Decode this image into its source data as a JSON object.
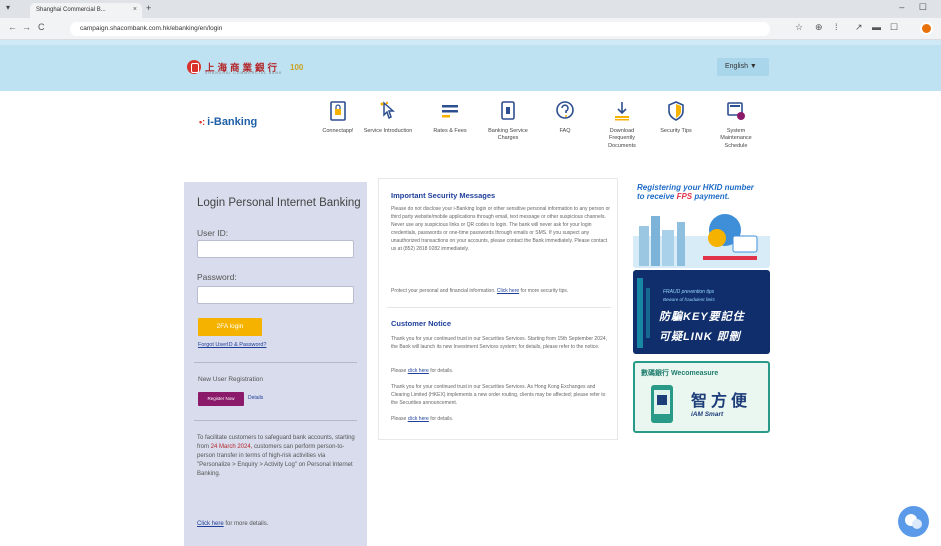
{
  "browser": {
    "tab_title": "Shanghai Commercial B...",
    "tab_close": "×",
    "new_tab": "+",
    "tabs_menu": "▾",
    "window_controls": "–  ☐",
    "nav": {
      "back": "←",
      "forward": "→",
      "reload": "C"
    },
    "url": "campaign.shacombank.com.hk/ebanking/en/login",
    "toolbar_icons": [
      "☆",
      "⊕",
      "⁞",
      "↗",
      "▬",
      "☐"
    ]
  },
  "header": {
    "bank_name": "上海商業銀行",
    "bank_name_en": "SHANGHAI COMMERCIAL BANK",
    "anniversary": "100",
    "language": "English ▼"
  },
  "ibanking": {
    "dots": "•:",
    "label": "i-Banking"
  },
  "menu": [
    {
      "label": "Connectapp!",
      "icon": "doc-lock-icon"
    },
    {
      "label": "Service Introduction",
      "icon": "pointer-icon"
    },
    {
      "label": "Rates & Fees",
      "icon": "rates-icon"
    },
    {
      "label": "Banking Service Charges",
      "icon": "document-icon"
    },
    {
      "label": "FAQ",
      "icon": "faq-icon"
    },
    {
      "label": "Download Frequently Documents",
      "icon": "download-icon"
    },
    {
      "label": "Security Tips",
      "icon": "shield-icon"
    },
    {
      "label": "System Maintenance Schedule",
      "icon": "maintenance-icon"
    }
  ],
  "login": {
    "title": "Login Personal Internet Banking",
    "user_id_label": "User ID:",
    "password_label": "Password:",
    "login_button": "2FA login",
    "forgot_link": "Forgot UserID & Password?",
    "new_user_label": "New User Registration",
    "register_button": "Register Now",
    "register_link": "Details",
    "notice_lead": "To facilitate customers to safeguard bank accounts, starting from",
    "notice_date": "24 March 2024,",
    "notice_rest": "customers can perform person-to-person transfer in terms of high-risk activities via \"Personalize > Enquiry > Activity Log\" on Personal Internet Banking.",
    "click_here": "Click here",
    "click_here_suffix": " for more details."
  },
  "security": {
    "heading": "Important Security Messages",
    "para1": "Please do not disclose your i-Banking login or other sensitive personal information to any person or third party website/mobile applications through email, text message or other suspicious channels. Never use any suspicious links or QR codes to login. The bank will never ask for your login credentials, passwords or one-time passwords through emails or SMS. If you suspect any unauthorized transactions on your accounts, please contact the Bank immediately. Please contact us at (852) 2818 0282 immediately.",
    "para2_prefix": "Protect your personal and financial information. ",
    "para2_link": "Click here",
    "para2_suffix": " for more security tips."
  },
  "customer_notice": {
    "heading": "Customer Notice",
    "para1": "Thank you for your continued trust in our Securities Services. Starting from 15th September 2024, the Bank will launch its new Investment Services system; for details, please refer to the notice.",
    "line2_prefix": "Please ",
    "line2_link": "click here",
    "line2_suffix": " for details.",
    "para3": "Thank you for your continued trust in our Securities Services. As Hong Kong Exchanges and Clearing Limited (HKEX) implements a new order routing, clients may be affected; please refer to the Securities announcement.",
    "line4_prefix": "Please ",
    "line4_link": "click here",
    "line4_suffix": " for details."
  },
  "banners": {
    "b1_line1": "Registering your HKID number",
    "b1_line2_prefix": "to receive ",
    "b1_line2_hl": "FPS",
    "b1_line2_suffix": " payment.",
    "b2_line1": "FRAUD prevention tips",
    "b2_line2": "Beware of fraudulent links",
    "b2_zh1": "防騙KEY要記住",
    "b2_zh2": "可疑LINK 即刪",
    "b3_title": "數碼銀行 Wecomeasure",
    "b3_big": "智方便",
    "b3_sub": "iAM Smart"
  },
  "colors": {
    "header_bg": "#bfe2f2",
    "brand_red": "#d9312b",
    "login_btn": "#f5b300",
    "register_btn": "#8b1a6b",
    "link": "#1f3f9a"
  }
}
